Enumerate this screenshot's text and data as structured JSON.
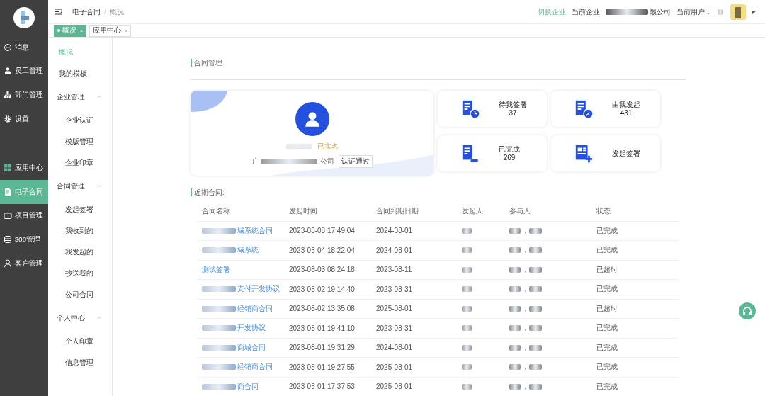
{
  "topbar": {
    "breadcrumb": [
      "电子合同",
      "概况"
    ],
    "breadcrumb_separator": "/",
    "switch_company": "切换企业",
    "company_label": "当前企业",
    "company_name_tail": "限公司",
    "user_label": "当前用户："
  },
  "tabs": [
    {
      "label": "概况",
      "selected": true,
      "close": "×"
    },
    {
      "label": "应用中心",
      "selected": false,
      "close": "×"
    }
  ],
  "nav_top": [
    {
      "label": "消息",
      "selected": false
    },
    {
      "label": "员工管理",
      "selected": false
    },
    {
      "label": "部门管理",
      "selected": false
    },
    {
      "label": "设置",
      "selected": false
    }
  ],
  "nav_bottom": [
    {
      "label": "应用中心",
      "selected": false
    },
    {
      "label": "电子合同",
      "selected": true
    },
    {
      "label": "项目管理",
      "selected": false
    },
    {
      "label": "sop管理",
      "selected": false
    },
    {
      "label": "客户管理",
      "selected": false
    }
  ],
  "submenu": [
    {
      "kind": "link",
      "label": "概况",
      "selected": true
    },
    {
      "kind": "link",
      "label": "我的模板",
      "selected": false
    },
    {
      "kind": "group",
      "label": "企业管理",
      "expanded": true,
      "children": [
        {
          "label": "企业认证",
          "selected": false
        },
        {
          "label": "模版管理",
          "selected": false
        },
        {
          "label": "企业印章",
          "selected": false
        }
      ]
    },
    {
      "kind": "group",
      "label": "合同管理",
      "expanded": true,
      "children": [
        {
          "label": "发起签署",
          "selected": false
        },
        {
          "label": "我收到的",
          "selected": false
        },
        {
          "label": "我发起的",
          "selected": false
        },
        {
          "label": "抄送我的",
          "selected": false
        },
        {
          "label": "公司合同",
          "selected": false
        }
      ]
    },
    {
      "kind": "group",
      "label": "个人中心",
      "expanded": true,
      "children": [
        {
          "label": "个人印章",
          "selected": false
        },
        {
          "label": "信息管理",
          "selected": false
        }
      ]
    }
  ],
  "section_title": "合同管理",
  "profile": {
    "status": "已实名",
    "company_head": "广",
    "company_tail": "公司",
    "badge": "认证通过"
  },
  "stats": [
    {
      "label": "待我签署",
      "count": "37"
    },
    {
      "label": "由我发起",
      "count": "431"
    },
    {
      "label": "已完成",
      "count": "269"
    },
    {
      "label": "发起签署"
    }
  ],
  "recent_title": "近期合同:",
  "table": {
    "columns": [
      "合同名称",
      "发起时间",
      "合同到期日期",
      "发起人",
      "参与人",
      "状态"
    ],
    "rows": [
      {
        "name": "域系统合同",
        "blurred": true,
        "time": "2023-08-08 17:49:04",
        "expire": "2024-08-01",
        "sep": "，",
        "status": "已完成"
      },
      {
        "name": "域系统",
        "blurred": true,
        "time": "2023-08-04 18:22:04",
        "expire": "2024-08-01",
        "sep": "，",
        "status": "已完成"
      },
      {
        "name": "测试签署",
        "blurred": false,
        "time": "2023-08-03 08:24:18",
        "expire": "2023-08-11",
        "sep": "，",
        "status": "已超时"
      },
      {
        "name": "支付开发协议",
        "blurred": true,
        "time": "2023-08-02 19:14:40",
        "expire": "2023-08-31",
        "sep": "，",
        "status": "已完成"
      },
      {
        "name": "经销商合同",
        "blurred": true,
        "time": "2023-08-02 13:35:08",
        "expire": "2025-08-01",
        "sep": "，",
        "status": "已超时"
      },
      {
        "name": "开发协议",
        "blurred": true,
        "time": "2023-08-01 19:41:10",
        "expire": "2023-08-31",
        "sep": "，",
        "status": "已完成"
      },
      {
        "name": "商城合同",
        "blurred": true,
        "time": "2023-08-01 19:31:29",
        "expire": "2024-08-01",
        "sep": "，",
        "status": "已完成"
      },
      {
        "name": "经销商合同",
        "blurred": true,
        "time": "2023-08-01 19:27:55",
        "expire": "2025-08-01",
        "sep": "，",
        "status": "已完成"
      },
      {
        "name": "商合同",
        "blurred": true,
        "time": "2023-08-01 17:37:53",
        "expire": "2025-08-01",
        "sep": "，",
        "status": "已完成"
      }
    ]
  }
}
